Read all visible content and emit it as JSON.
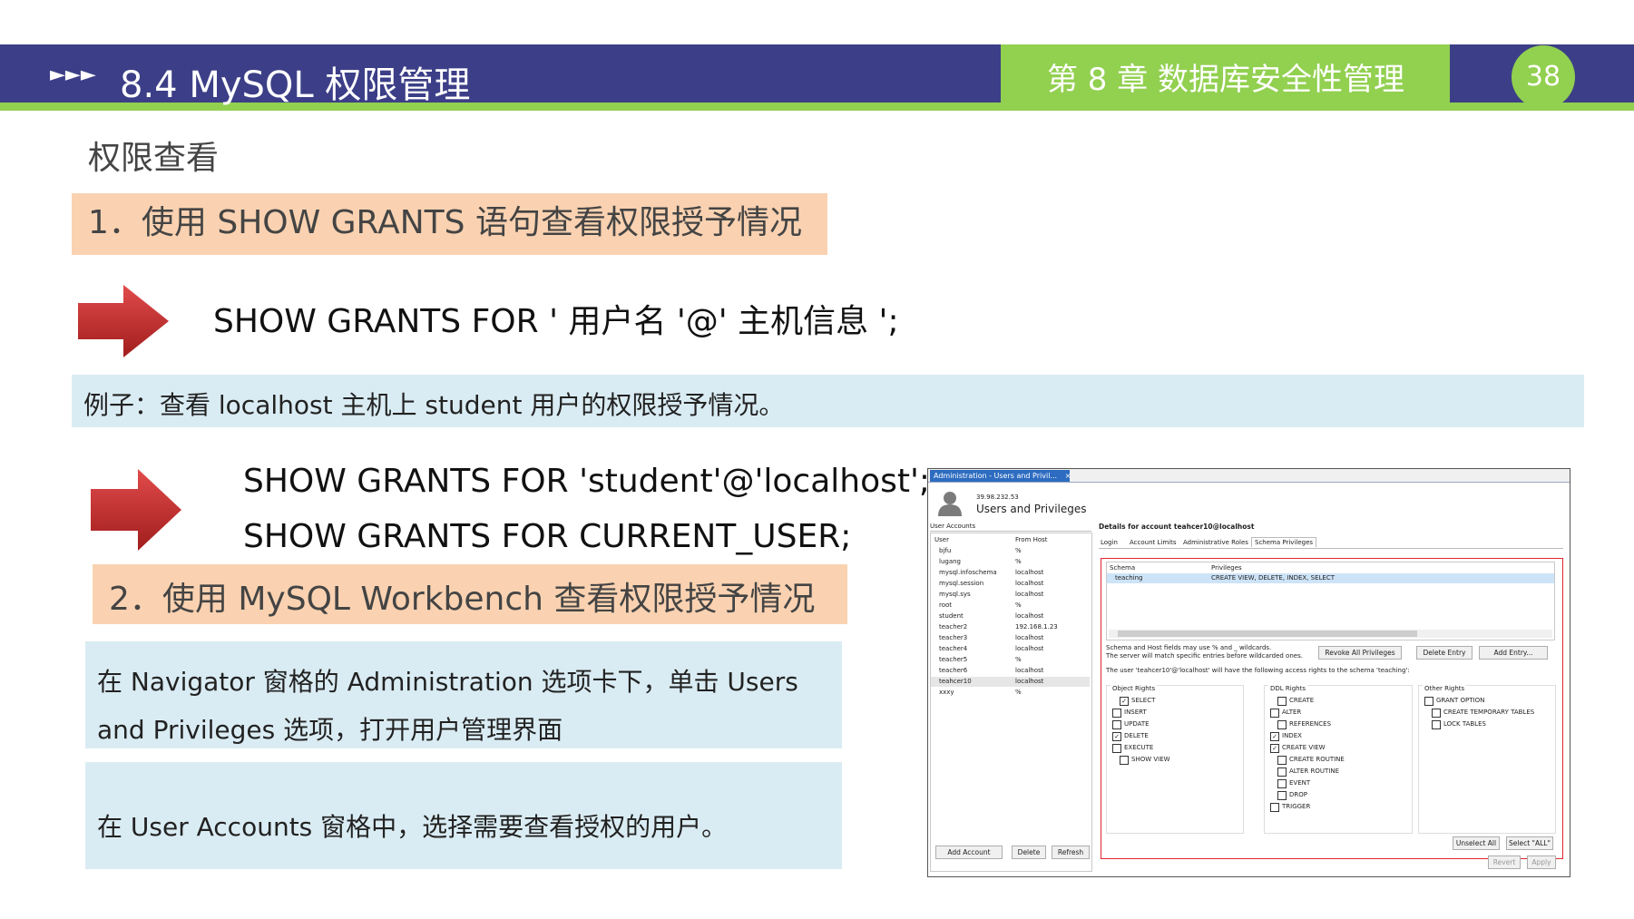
{
  "header": {
    "arrows": "►►►",
    "title": "8.4  MySQL 权限管理",
    "chapter": "第 8 章   数据库安全性管理",
    "page_number": "38",
    "colors": {
      "bar": "#3c3f87",
      "accent": "#92d050"
    }
  },
  "section_title": "权限查看",
  "item1": "1．使用 SHOW GRANTS 语句查看权限授予情况",
  "syntax": "SHOW GRANTS FOR ' 用户名 '@' 主机信息 ';",
  "example": "例子：查看 localhost 主机上 student 用户的权限授予情况。",
  "code": [
    "SHOW GRANTS FOR 'student'@'localhost';",
    "SHOW GRANTS FOR CURRENT_USER;"
  ],
  "item2": "2．使用 MySQL Workbench 查看权限授予情况",
  "note1": "在 Navigator 窗格的 Administration 选项卡下，单击 Users and Privileges 选项，打开用户管理界面",
  "note2": "在 User Accounts 窗格中，选择需要查看授权的用户。",
  "workbench": {
    "tab_title": "Administration - Users and Privil...",
    "tab_close": "×",
    "server_ip": "39.98.232.53",
    "heading": "Users and Privileges",
    "user_accounts_label": "User Accounts",
    "columns": [
      "User",
      "From Host"
    ],
    "users": [
      [
        "bjfu",
        "%"
      ],
      [
        "lugang",
        "%"
      ],
      [
        "mysql.infoschema",
        "localhost"
      ],
      [
        "mysql.session",
        "localhost"
      ],
      [
        "mysql.sys",
        "localhost"
      ],
      [
        "root",
        "%"
      ],
      [
        "student",
        "localhost"
      ],
      [
        "teacher2",
        "192.168.1.23"
      ],
      [
        "teacher3",
        "localhost"
      ],
      [
        "teacher4",
        "localhost"
      ],
      [
        "teacher5",
        "%"
      ],
      [
        "teacher6",
        "localhost"
      ],
      [
        "teahcer10",
        "localhost"
      ],
      [
        "xxxy",
        "%"
      ]
    ],
    "details_label": "Details for account teahcer10@localhost",
    "detail_tabs": [
      "Login",
      "Account Limits",
      "Administrative Roles",
      "Schema Privileges"
    ],
    "schema_columns": [
      "Schema",
      "Privileges"
    ],
    "schema_rows": [
      [
        "teaching",
        "CREATE VIEW, DELETE, INDEX, SELECT"
      ]
    ],
    "info_line1": "Schema and Host fields may use % and _ wildcards.",
    "info_line2": "The server will match specific entries before wildcarded ones.",
    "info_line3": "The user 'teahcer10'@'localhost' will have the following access rights to the schema 'teaching':",
    "buttons_right": [
      "Revoke All Privileges",
      "Delete Entry",
      "Add Entry..."
    ],
    "object_rights": {
      "label": "Object Rights",
      "items": [
        {
          "label": "SELECT",
          "checked": true,
          "indent": 1
        },
        {
          "label": "INSERT",
          "checked": false,
          "indent": 0
        },
        {
          "label": "UPDATE",
          "checked": false,
          "indent": 0
        },
        {
          "label": "DELETE",
          "checked": true,
          "indent": 0
        },
        {
          "label": "EXECUTE",
          "checked": false,
          "indent": 0
        },
        {
          "label": "SHOW VIEW",
          "checked": false,
          "indent": 1
        }
      ]
    },
    "ddl_rights": {
      "label": "DDL Rights",
      "items": [
        {
          "label": "CREATE",
          "checked": false,
          "indent": 1
        },
        {
          "label": "ALTER",
          "checked": false,
          "indent": 0
        },
        {
          "label": "REFERENCES",
          "checked": false,
          "indent": 1
        },
        {
          "label": "INDEX",
          "checked": true,
          "indent": 0
        },
        {
          "label": "CREATE VIEW",
          "checked": true,
          "indent": 0
        },
        {
          "label": "CREATE ROUTINE",
          "checked": false,
          "indent": 1
        },
        {
          "label": "ALTER ROUTINE",
          "checked": false,
          "indent": 1
        },
        {
          "label": "EVENT",
          "checked": false,
          "indent": 1
        },
        {
          "label": "DROP",
          "checked": false,
          "indent": 1
        },
        {
          "label": "TRIGGER",
          "checked": false,
          "indent": 0
        }
      ]
    },
    "other_rights": {
      "label": "Other Rights",
      "items": [
        {
          "label": "GRANT OPTION",
          "checked": false,
          "indent": 0
        },
        {
          "label": "CREATE TEMPORARY TABLES",
          "checked": false,
          "indent": 1
        },
        {
          "label": "LOCK TABLES",
          "checked": false,
          "indent": 1
        }
      ]
    },
    "bottom_left_buttons": [
      "Add Account",
      "Delete",
      "Refresh"
    ],
    "bottom_right_buttons": [
      "Unselect All",
      "Select \"ALL\""
    ],
    "footer_buttons": [
      "Revert",
      "Apply"
    ]
  }
}
